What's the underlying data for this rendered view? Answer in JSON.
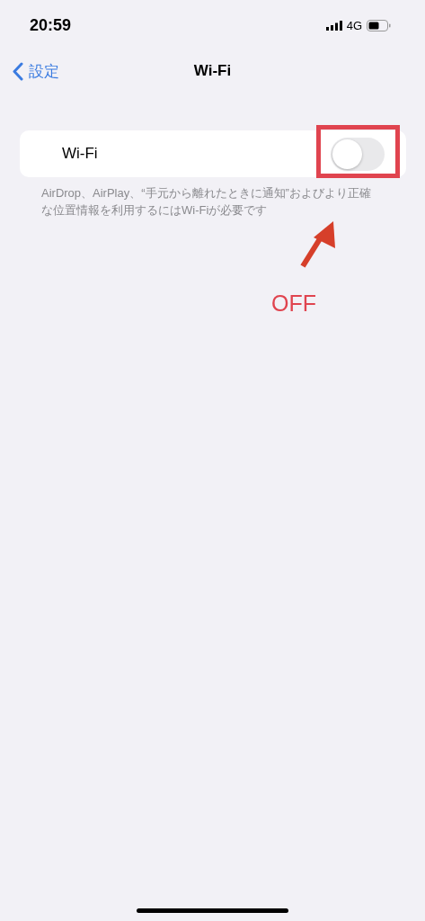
{
  "status_bar": {
    "time": "20:59",
    "network": "4G"
  },
  "nav": {
    "back": "設定",
    "title": "Wi-Fi"
  },
  "wifi_row": {
    "label": "Wi-Fi",
    "on": false
  },
  "footnote": "AirDrop、AirPlay、“手元から離れたときに通知”およびより正確な位置情報を利用するにはWi-Fiが必要です",
  "annotation": {
    "label": "OFF"
  }
}
